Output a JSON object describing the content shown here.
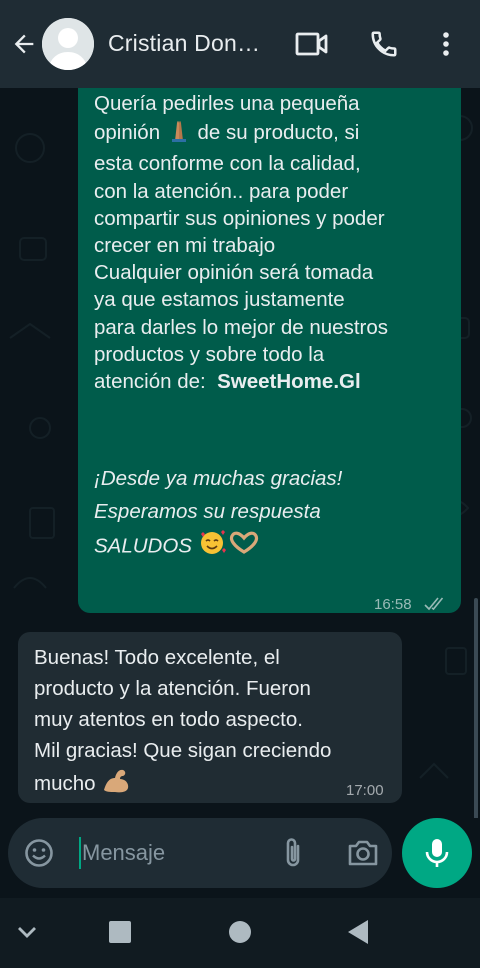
{
  "header": {
    "contact_name": "Cristian  Don…",
    "icons": [
      "back-arrow-icon",
      "video-call-icon",
      "phone-icon",
      "more-vert-icon"
    ]
  },
  "messages": [
    {
      "direction": "outgoing",
      "lines_top": [
        "Quería pedirles una pequeña",
        "opinión",
        "de su producto, si",
        "esta conforme con la calidad,",
        "con la atención.. para poder",
        "compartir sus opiniones y poder",
        "crecer en mi trabajo",
        "Cualquier opinión será tomada",
        "ya que estamos justamente",
        "para darles lo mejor de nuestros",
        "productos y sobre todo la",
        "atención de:"
      ],
      "brand": "SweetHome.Gl",
      "lines_bottom": [
        "¡Desde ya muchas gracias!",
        "Esperamos su respuesta",
        "SALUDOS"
      ],
      "time": "16:58",
      "status": "double-check"
    },
    {
      "direction": "incoming",
      "lines": [
        "Buenas! Todo excelente, el",
        "producto y la atención. Fueron",
        "muy atentos en todo aspecto.",
        "Mil gracias! Que sigan creciendo",
        "mucho"
      ],
      "time": "17:00"
    }
  ],
  "composer": {
    "placeholder": "Mensaje"
  },
  "colors": {
    "outgoing_bubble": "#005c4b",
    "incoming_bubble": "#202c33",
    "accent": "#00a884",
    "background": "#0b141a"
  }
}
